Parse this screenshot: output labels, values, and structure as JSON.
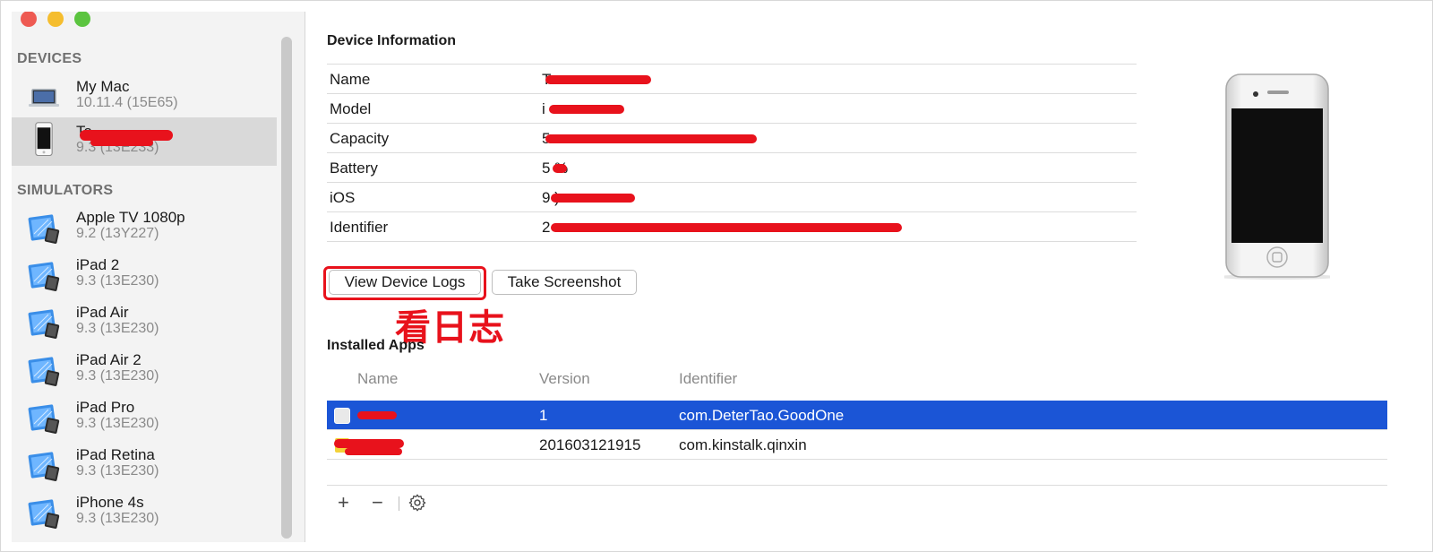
{
  "sidebar": {
    "devices_title": "DEVICES",
    "simulators_title": "SIMULATORS",
    "devices": [
      {
        "name": "My Mac",
        "sub": "10.11.4 (15E65)",
        "icon": "laptop-icon",
        "selected": false
      },
      {
        "name": "Ta",
        "sub": "9.3 (13E233)",
        "icon": "iphone-icon",
        "selected": true
      }
    ],
    "simulators": [
      {
        "name": "Apple TV 1080p",
        "sub": "9.2 (13Y227)",
        "icon": "simulator-icon"
      },
      {
        "name": "iPad 2",
        "sub": "9.3 (13E230)",
        "icon": "simulator-icon"
      },
      {
        "name": "iPad Air",
        "sub": "9.3 (13E230)",
        "icon": "simulator-icon"
      },
      {
        "name": "iPad Air 2",
        "sub": "9.3 (13E230)",
        "icon": "simulator-icon"
      },
      {
        "name": "iPad Pro",
        "sub": "9.3 (13E230)",
        "icon": "simulator-icon"
      },
      {
        "name": "iPad Retina",
        "sub": "9.3 (13E230)",
        "icon": "simulator-icon"
      },
      {
        "name": "iPhone 4s",
        "sub": "9.3 (13E230)",
        "icon": "simulator-icon"
      }
    ]
  },
  "device_info": {
    "title": "Device Information",
    "rows": [
      {
        "label": "Name",
        "value": "T"
      },
      {
        "label": "Model",
        "value": "i"
      },
      {
        "label": "Capacity",
        "value": "5"
      },
      {
        "label": "Battery",
        "value": "5 %"
      },
      {
        "label": "iOS",
        "value": "9 )"
      },
      {
        "label": "Identifier",
        "value": "2"
      }
    ]
  },
  "buttons": {
    "view_logs": "View Device Logs",
    "take_screenshot": "Take Screenshot"
  },
  "annotation": {
    "text": "看日志",
    "color": "#e8121c"
  },
  "installed_apps": {
    "title": "Installed Apps",
    "columns": [
      "Name",
      "Version",
      "Identifier"
    ],
    "rows": [
      {
        "name": "",
        "version": "1",
        "identifier": "com.DeterTao.GoodOne",
        "selected": true
      },
      {
        "name": "",
        "version": "201603121915",
        "identifier": "com.kinstalk.qinxin",
        "selected": false
      }
    ]
  },
  "bottom_bar": {
    "add": "+",
    "remove": "−"
  },
  "colors": {
    "selection_blue": "#1b55d6",
    "redaction_red": "#e8121c"
  }
}
